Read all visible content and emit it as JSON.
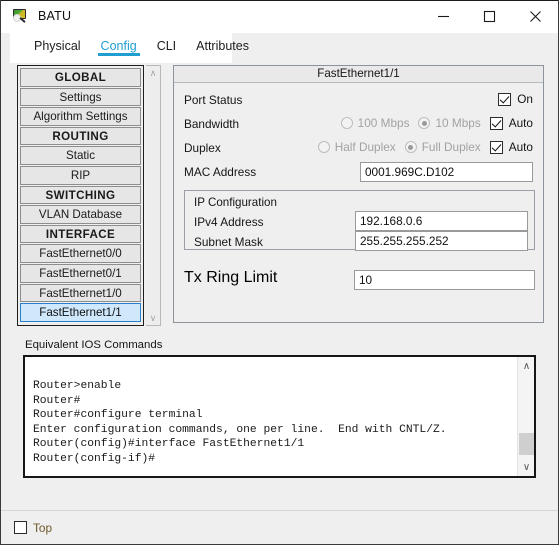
{
  "window": {
    "title": "BATU",
    "icon": "router-magnifier-icon",
    "controls": {
      "minimize": "minimize-icon",
      "maximize": "maximize-icon",
      "close": "close-icon"
    }
  },
  "tabs": [
    {
      "label": "Physical",
      "active": false
    },
    {
      "label": "Config",
      "active": true
    },
    {
      "label": "CLI",
      "active": false
    },
    {
      "label": "Attributes",
      "active": false
    }
  ],
  "sidebar": {
    "items": [
      {
        "label": "GLOBAL",
        "type": "header",
        "selected": false
      },
      {
        "label": "Settings",
        "type": "item",
        "selected": false
      },
      {
        "label": "Algorithm Settings",
        "type": "item",
        "selected": false
      },
      {
        "label": "ROUTING",
        "type": "header",
        "selected": false
      },
      {
        "label": "Static",
        "type": "item",
        "selected": false
      },
      {
        "label": "RIP",
        "type": "item",
        "selected": false
      },
      {
        "label": "SWITCHING",
        "type": "header",
        "selected": false
      },
      {
        "label": "VLAN Database",
        "type": "item",
        "selected": false
      },
      {
        "label": "INTERFACE",
        "type": "header",
        "selected": false
      },
      {
        "label": "FastEthernet0/0",
        "type": "item",
        "selected": false
      },
      {
        "label": "FastEthernet0/1",
        "type": "item",
        "selected": false
      },
      {
        "label": "FastEthernet1/0",
        "type": "item",
        "selected": false
      },
      {
        "label": "FastEthernet1/1",
        "type": "item",
        "selected": true
      }
    ],
    "scroll_up": "∧",
    "scroll_down": "∨"
  },
  "config": {
    "panel_title": "FastEthernet1/1",
    "port_status": {
      "label": "Port Status",
      "checkbox_label": "On",
      "checked": true
    },
    "bandwidth": {
      "label": "Bandwidth",
      "option_100": "100 Mbps",
      "option_10": "10 Mbps",
      "selected": "10 Mbps",
      "auto_label": "Auto",
      "auto_checked": true
    },
    "duplex": {
      "label": "Duplex",
      "option_half": "Half Duplex",
      "option_full": "Full Duplex",
      "selected": "Full Duplex",
      "auto_label": "Auto",
      "auto_checked": true
    },
    "mac_address": {
      "label": "MAC Address",
      "value": "0001.969C.D102"
    },
    "ip_configuration": {
      "group_label": "IP Configuration",
      "ipv4_label": "IPv4 Address",
      "ipv4_value": "192.168.0.6",
      "subnet_label": "Subnet Mask",
      "subnet_value": "255.255.255.252"
    },
    "tx_ring_limit": {
      "label": "Tx Ring Limit",
      "value": "10"
    }
  },
  "ios": {
    "label": "Equivalent IOS Commands",
    "text": "Router>enable\nRouter#\nRouter#configure terminal\nEnter configuration commands, one per line.  End with CNTL/Z.\nRouter(config)#interface FastEthernet1/1\nRouter(config-if)#",
    "scroll_up": "∧",
    "scroll_down": "∨"
  },
  "footer": {
    "top_label": "Top",
    "top_checked": false
  },
  "colors": {
    "accent": "#1f9ed2",
    "selection_bg": "#cfe8fb",
    "selection_border": "#2a7fc9",
    "panel_bg": "#efefef"
  }
}
